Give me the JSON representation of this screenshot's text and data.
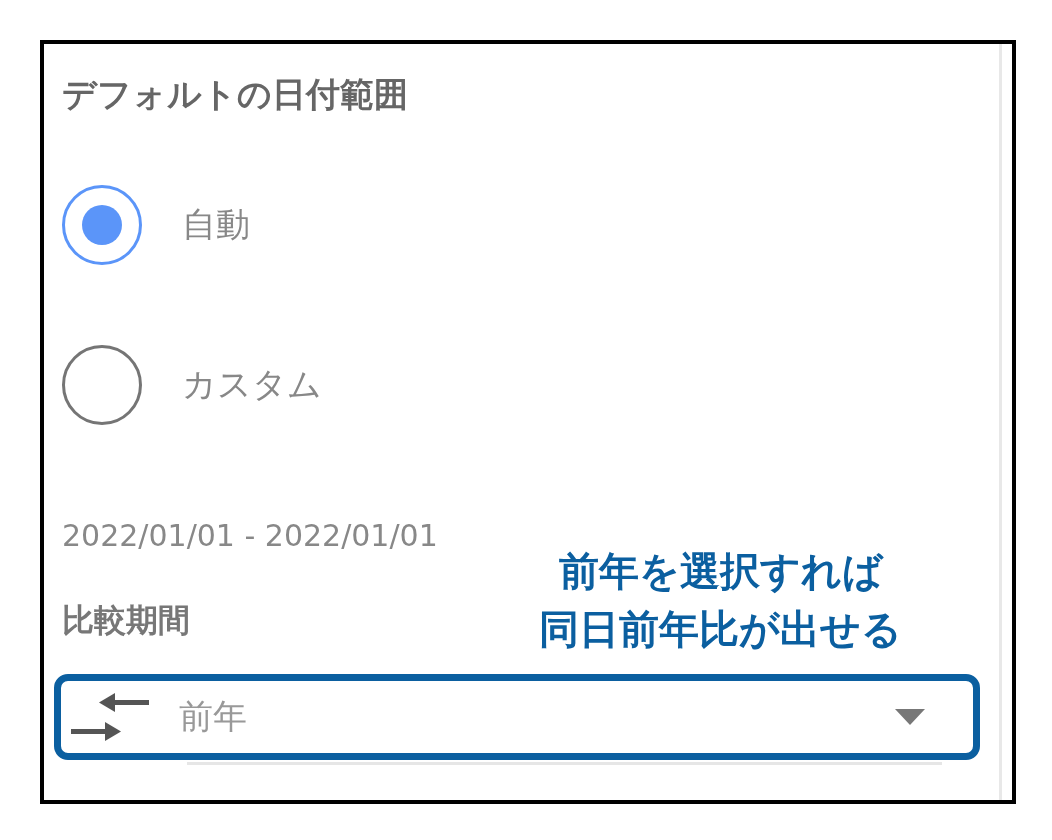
{
  "section": {
    "title": "デフォルトの日付範囲"
  },
  "options": [
    {
      "label": "自動",
      "selected": true
    },
    {
      "label": "カスタム",
      "selected": false
    }
  ],
  "date_range": "2022/01/01 - 2022/01/01",
  "comparison": {
    "label": "比較期間",
    "value": "前年"
  },
  "annotation": {
    "lines": [
      "前年を選択すれば",
      "同日前年比が出せる"
    ]
  }
}
